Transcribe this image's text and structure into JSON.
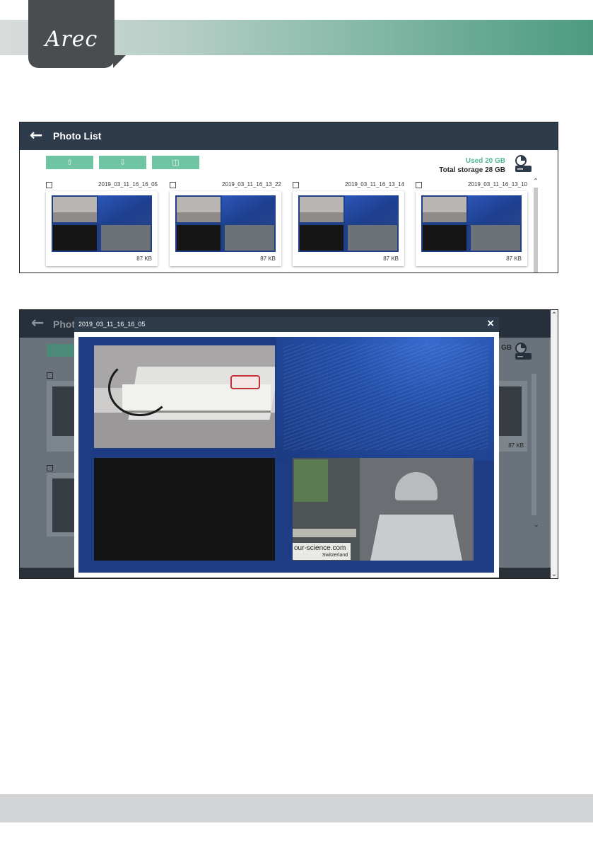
{
  "brand": {
    "logo_text": "Arec"
  },
  "photo_list": {
    "title": "Photo List",
    "toolbar": {
      "upload_icon": "upload-icon",
      "download_icon": "download-icon",
      "delete_icon": "trash-icon"
    },
    "storage": {
      "used_label": "Used",
      "used_value": "20 GB",
      "total_label": "Total storage",
      "total_value": "28 GB"
    },
    "photos": [
      {
        "name": "2019_03_11_16_16_05",
        "size": "87 KB"
      },
      {
        "name": "2019_03_11_16_13_22",
        "size": "87 KB"
      },
      {
        "name": "2019_03_11_16_13_14",
        "size": "87 KB"
      },
      {
        "name": "2019_03_11_16_13_10",
        "size": "87 KB"
      }
    ]
  },
  "preview": {
    "ghost_title": "Photo List",
    "modal_title": "2019_03_11_16_16_05",
    "close_label": "×",
    "ghost_storage_value": "GB",
    "ghost_size": "87 KB",
    "image_caption": "our-science.com",
    "image_sub": "Switzerland"
  },
  "colors": {
    "accent": "#6fc4a3",
    "header": "#2e3b4a",
    "used": "#53b994"
  }
}
